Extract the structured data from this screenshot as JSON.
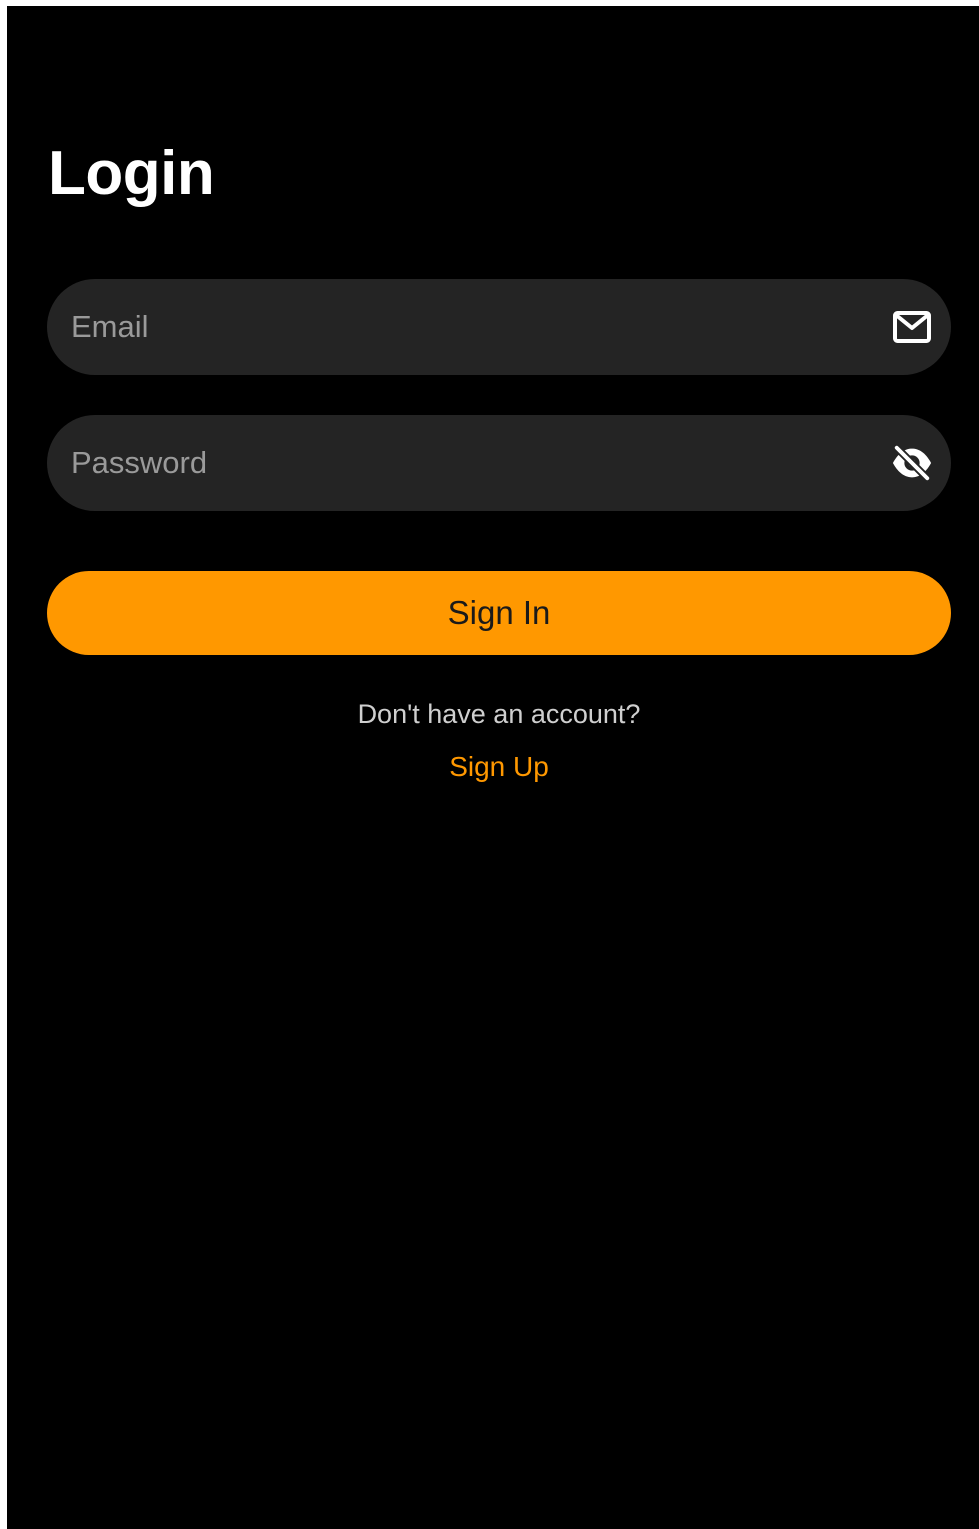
{
  "page": {
    "title": "Login"
  },
  "form": {
    "email": {
      "placeholder": "Email",
      "value": "",
      "icon": "mail-icon"
    },
    "password": {
      "placeholder": "Password",
      "value": "",
      "icon": "eye-off-icon"
    },
    "signin_label": "Sign In"
  },
  "footer": {
    "prompt": "Don't have an account?",
    "signup_label": "Sign Up"
  },
  "colors": {
    "background": "#000000",
    "field": "#242424",
    "accent": "#ff9800",
    "text": "#ffffff",
    "muted": "#9a9a9a"
  }
}
